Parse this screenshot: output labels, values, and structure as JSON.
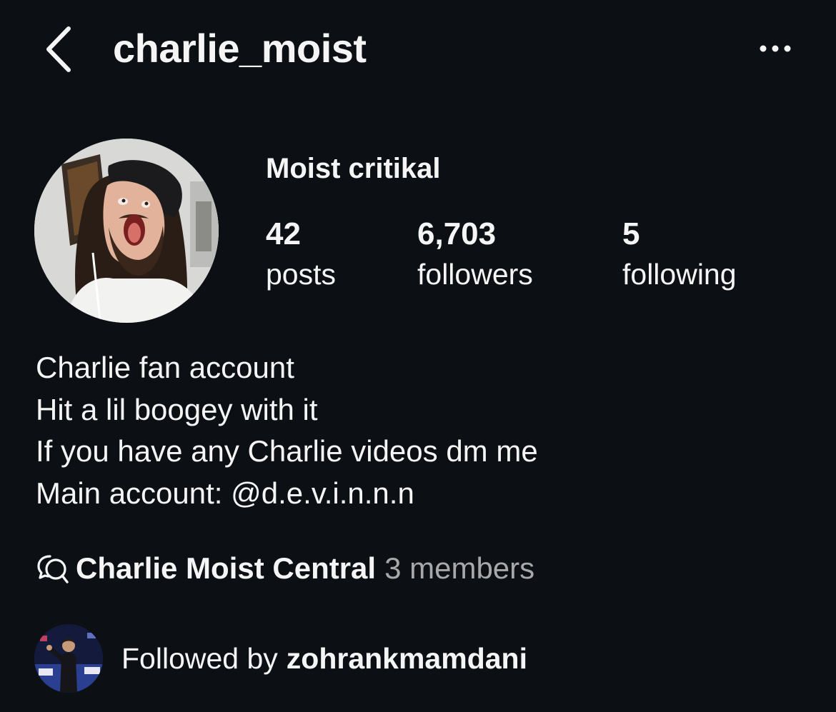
{
  "header": {
    "username": "charlie_moist",
    "back_icon": "chevron-left-icon",
    "more_icon": "more-horizontal-icon"
  },
  "profile": {
    "display_name": "Moist critikal",
    "stats": {
      "posts": {
        "value": "42",
        "label": "posts"
      },
      "followers": {
        "value": "6,703",
        "label": "followers"
      },
      "following": {
        "value": "5",
        "label": "following"
      }
    },
    "bio": [
      "Charlie fan account",
      "Hit a lil boogey with it",
      "If you have any Charlie videos dm me",
      "Main account: @d.e.v.i.n.n.n"
    ]
  },
  "community": {
    "icon": "chat-bubbles-icon",
    "name": "Charlie Moist Central",
    "members": "3 members"
  },
  "followed_by": {
    "prefix": "Followed by",
    "user": "zohrankmamdani"
  },
  "colors": {
    "background": "#0c1014",
    "text": "#f5f5f5",
    "muted": "#a8a8a8"
  }
}
